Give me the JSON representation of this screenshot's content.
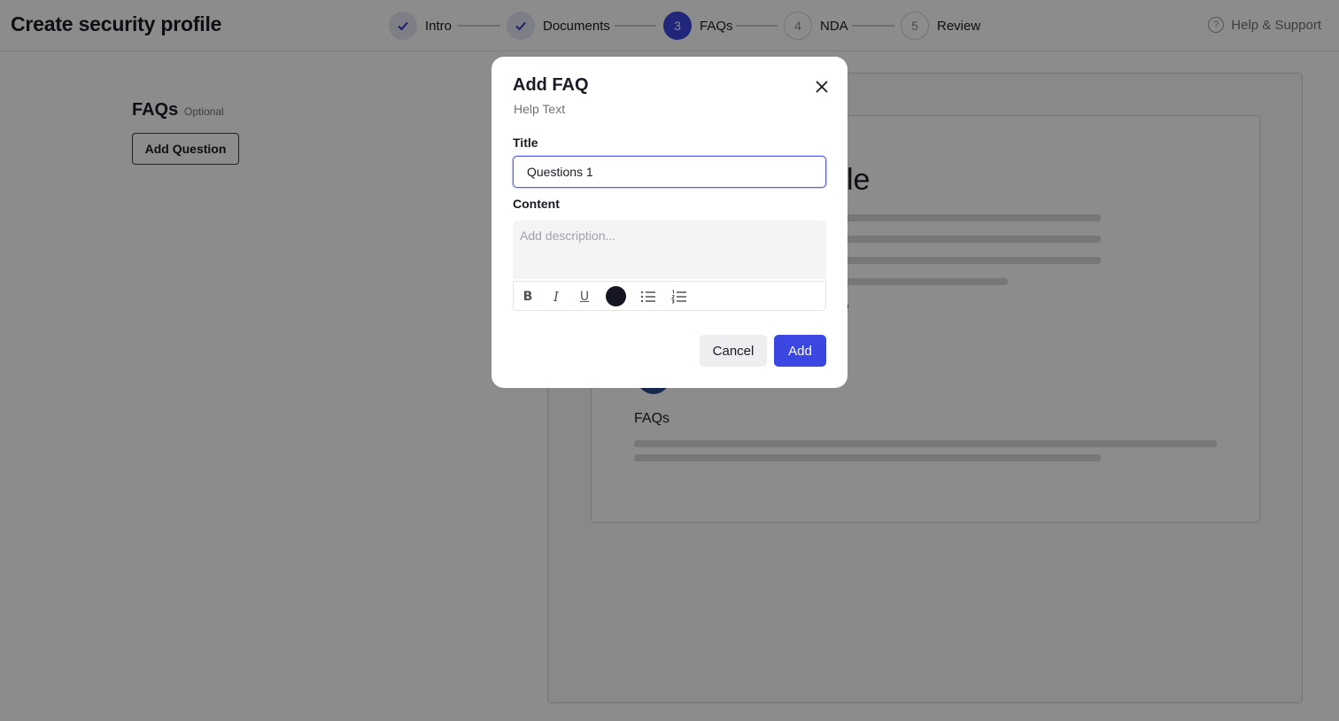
{
  "header": {
    "title": "Create security profile",
    "steps": [
      {
        "label": "Intro",
        "number": "1",
        "status": "done"
      },
      {
        "label": "Documents",
        "number": "2",
        "status": "done"
      },
      {
        "label": "FAQs",
        "number": "3",
        "status": "active"
      },
      {
        "label": "NDA",
        "number": "4",
        "status": "pending"
      },
      {
        "label": "Review",
        "number": "5",
        "status": "pending"
      }
    ],
    "help_label": "Help & Support",
    "help_icon": "?"
  },
  "main": {
    "section_title": "FAQs",
    "optional_label": "Optional",
    "add_question_label": "Add Question"
  },
  "preview": {
    "title_fragment": "le",
    "faqs_heading": "FAQs"
  },
  "modal": {
    "title": "Add FAQ",
    "help_text": "Help Text",
    "title_label": "Title",
    "title_value": "Questions 1",
    "content_label": "Content",
    "content_placeholder": "Add description...",
    "toolbar": {
      "bold": "B",
      "italic": "I",
      "underline": "U",
      "text_color": "#151621"
    },
    "cancel_label": "Cancel",
    "add_label": "Add"
  },
  "colors": {
    "accent": "#3b47e0",
    "overlay": "rgba(0,0,0,0.45)"
  }
}
